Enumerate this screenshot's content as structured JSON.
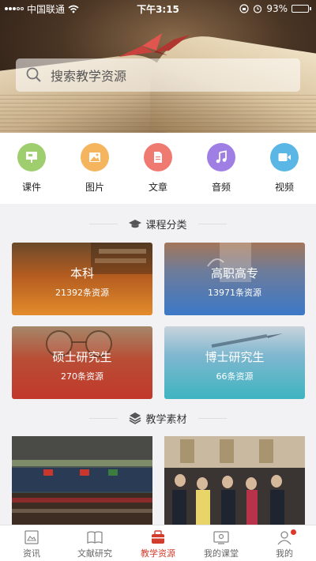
{
  "status_bar": {
    "carrier": "中国联通",
    "time": "下午3:15",
    "battery_percent": "93%",
    "battery_level": 0.93,
    "icons": [
      "signal-icon",
      "wifi-icon",
      "orientation-lock-icon",
      "alarm-icon",
      "battery-icon"
    ]
  },
  "search": {
    "placeholder": "搜索教学资源",
    "icon": "search-icon"
  },
  "quick_links": [
    {
      "label": "课件",
      "icon": "presentation-icon",
      "color": "#9fce6e"
    },
    {
      "label": "图片",
      "icon": "image-icon",
      "color": "#f4b55e"
    },
    {
      "label": "文章",
      "icon": "document-icon",
      "color": "#ef7a72"
    },
    {
      "label": "音频",
      "icon": "music-icon",
      "color": "#9f7fe4"
    },
    {
      "label": "视频",
      "icon": "video-icon",
      "color": "#5ab6e4"
    }
  ],
  "course_section": {
    "title": "课程分类",
    "icon": "graduation-cap-icon",
    "categories": [
      {
        "title": "本科",
        "count": "21392条资源"
      },
      {
        "title": "高职高专",
        "count": "13971条资源"
      },
      {
        "title": "硕士研究生",
        "count": "270条资源"
      },
      {
        "title": "博士研究生",
        "count": "66条资源"
      }
    ]
  },
  "material_section": {
    "title": "教学素材",
    "icon": "layers-icon",
    "photos": [
      "ceremony-photo",
      "delegation-photo"
    ]
  },
  "tabbar": {
    "active": "教学资源",
    "accent": "#d23c2c",
    "tabs": [
      {
        "label": "资讯",
        "icon": "news-icon"
      },
      {
        "label": "文献研究",
        "icon": "book-icon"
      },
      {
        "label": "教学资源",
        "icon": "resource-bag-icon"
      },
      {
        "label": "我的课堂",
        "icon": "classroom-icon"
      },
      {
        "label": "我的",
        "icon": "user-icon"
      }
    ]
  }
}
